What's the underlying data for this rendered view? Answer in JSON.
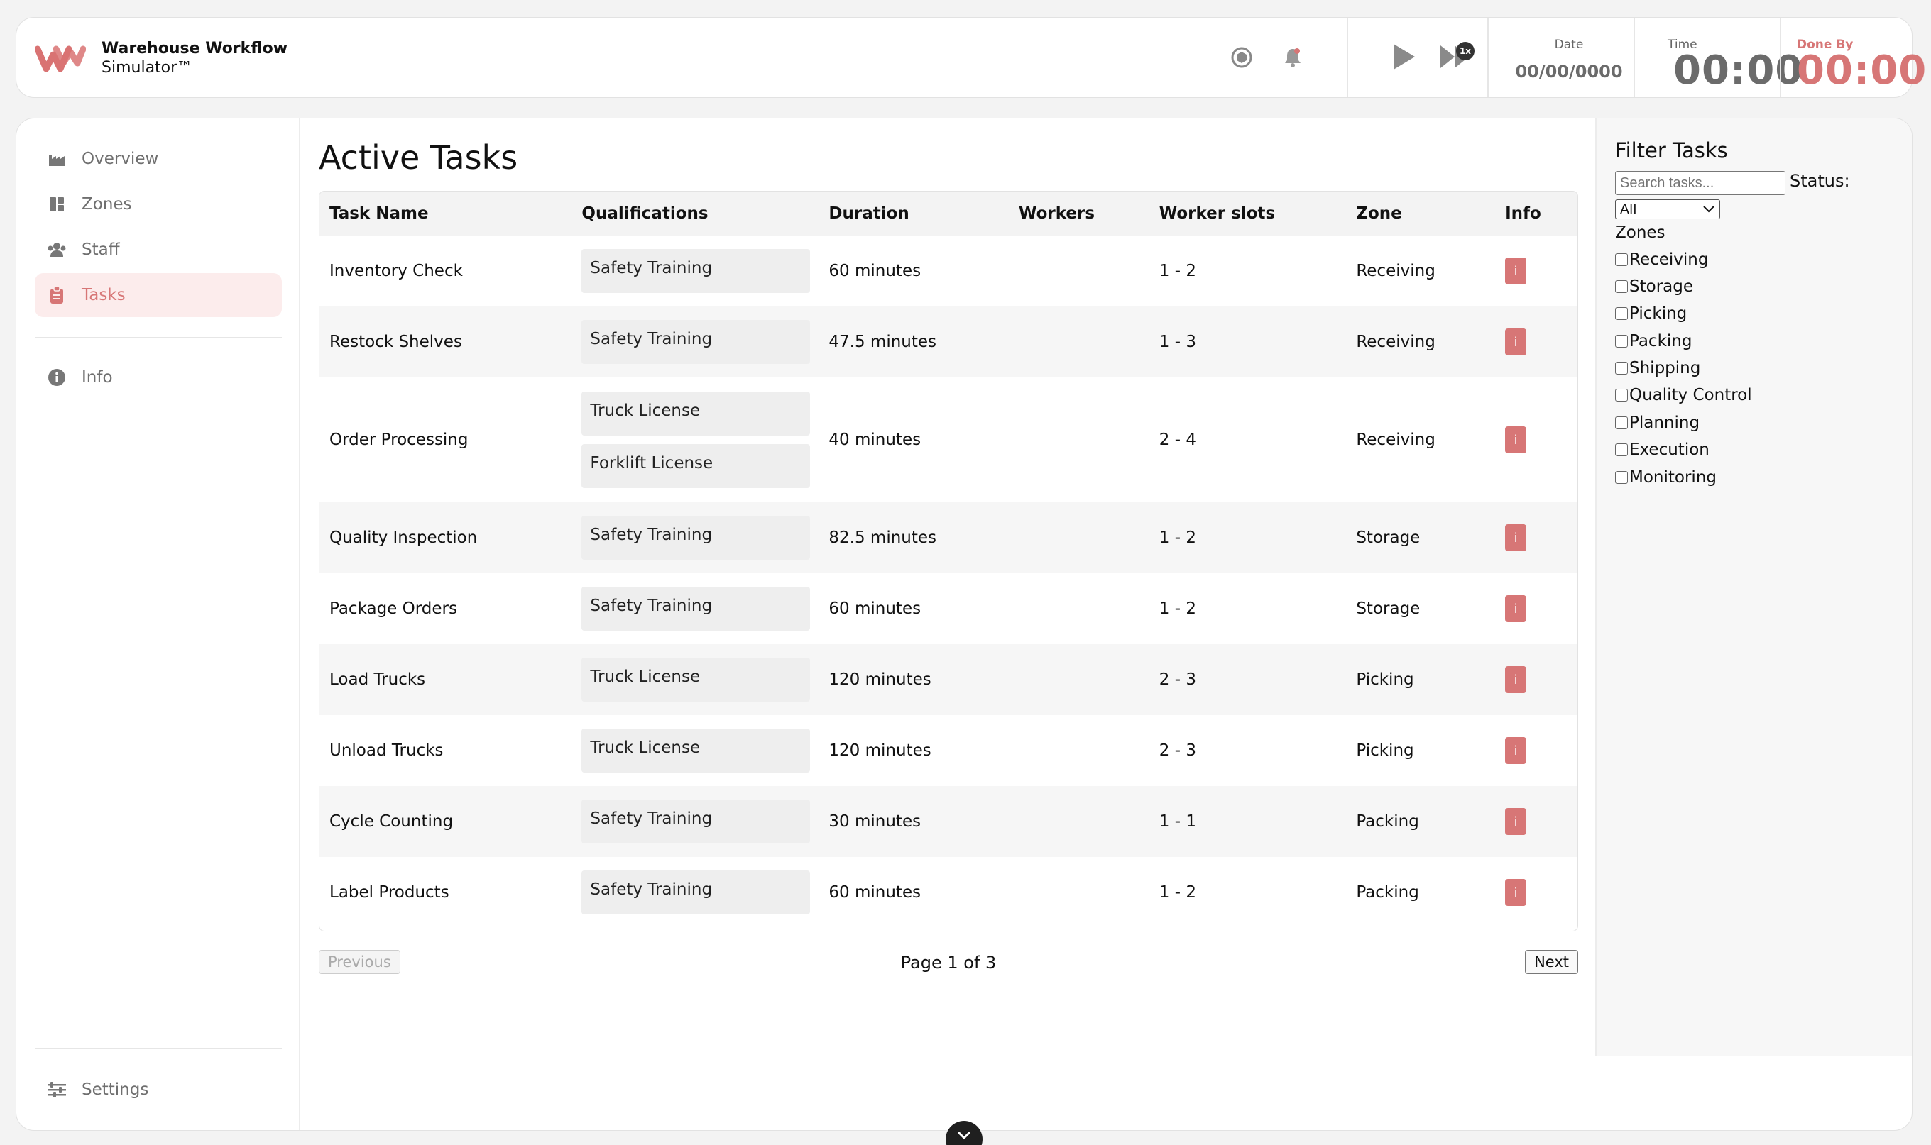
{
  "app": {
    "title_line1": "Warehouse Workflow",
    "title_line2": "Simulator™",
    "brand_color": "#d97373"
  },
  "header": {
    "icons": [
      "cube-icon",
      "bell-icon",
      "play-icon",
      "fast-forward-icon"
    ],
    "speed_badge": "1x",
    "date_label": "Date",
    "date_value": "00/00/0000",
    "time_label": "Time",
    "time_value": "00:00",
    "done_label": "Done By",
    "done_value": "00:00",
    "accent_color": "#d77676"
  },
  "sidebar": {
    "items": [
      {
        "label": "Overview",
        "icon": "factory-icon"
      },
      {
        "label": "Zones",
        "icon": "grid-icon"
      },
      {
        "label": "Staff",
        "icon": "users-icon"
      },
      {
        "label": "Tasks",
        "icon": "clipboard-icon",
        "active": true
      }
    ],
    "info_label": "Info",
    "settings_label": "Settings"
  },
  "main": {
    "title": "Active Tasks",
    "columns": [
      "Task Name",
      "Qualifications",
      "Duration",
      "Workers",
      "Worker slots",
      "Zone",
      "Info"
    ],
    "info_button": "i",
    "rows": [
      {
        "name": "Inventory Check",
        "quals": [
          "Safety Training"
        ],
        "duration": "60 minutes",
        "workers": "",
        "slots": "1 - 2",
        "zone": "Receiving"
      },
      {
        "name": "Restock Shelves",
        "quals": [
          "Safety Training"
        ],
        "duration": "47.5 minutes",
        "workers": "",
        "slots": "1 - 3",
        "zone": "Receiving"
      },
      {
        "name": "Order Processing",
        "quals": [
          "Truck License",
          "Forklift License"
        ],
        "duration": "40 minutes",
        "workers": "",
        "slots": "2 - 4",
        "zone": "Receiving"
      },
      {
        "name": "Quality Inspection",
        "quals": [
          "Safety Training"
        ],
        "duration": "82.5 minutes",
        "workers": "",
        "slots": "1 - 2",
        "zone": "Storage"
      },
      {
        "name": "Package Orders",
        "quals": [
          "Safety Training"
        ],
        "duration": "60 minutes",
        "workers": "",
        "slots": "1 - 2",
        "zone": "Storage"
      },
      {
        "name": "Load Trucks",
        "quals": [
          "Truck License"
        ],
        "duration": "120 minutes",
        "workers": "",
        "slots": "2 - 3",
        "zone": "Picking"
      },
      {
        "name": "Unload Trucks",
        "quals": [
          "Truck License"
        ],
        "duration": "120 minutes",
        "workers": "",
        "slots": "2 - 3",
        "zone": "Picking"
      },
      {
        "name": "Cycle Counting",
        "quals": [
          "Safety Training"
        ],
        "duration": "30 minutes",
        "workers": "",
        "slots": "1 - 1",
        "zone": "Packing"
      },
      {
        "name": "Label Products",
        "quals": [
          "Safety Training"
        ],
        "duration": "60 minutes",
        "workers": "",
        "slots": "1 - 2",
        "zone": "Packing"
      }
    ],
    "pagination": {
      "previous": "Previous",
      "next": "Next",
      "page_text": "Page 1 of 3"
    }
  },
  "filters": {
    "title": "Filter Tasks",
    "search_placeholder": "Search tasks...",
    "status_label": "Status:",
    "status_value": "All",
    "zones_label": "Zones",
    "zones": [
      "Receiving",
      "Storage",
      "Picking",
      "Packing",
      "Shipping",
      "Quality Control",
      "Planning",
      "Execution",
      "Monitoring"
    ]
  }
}
